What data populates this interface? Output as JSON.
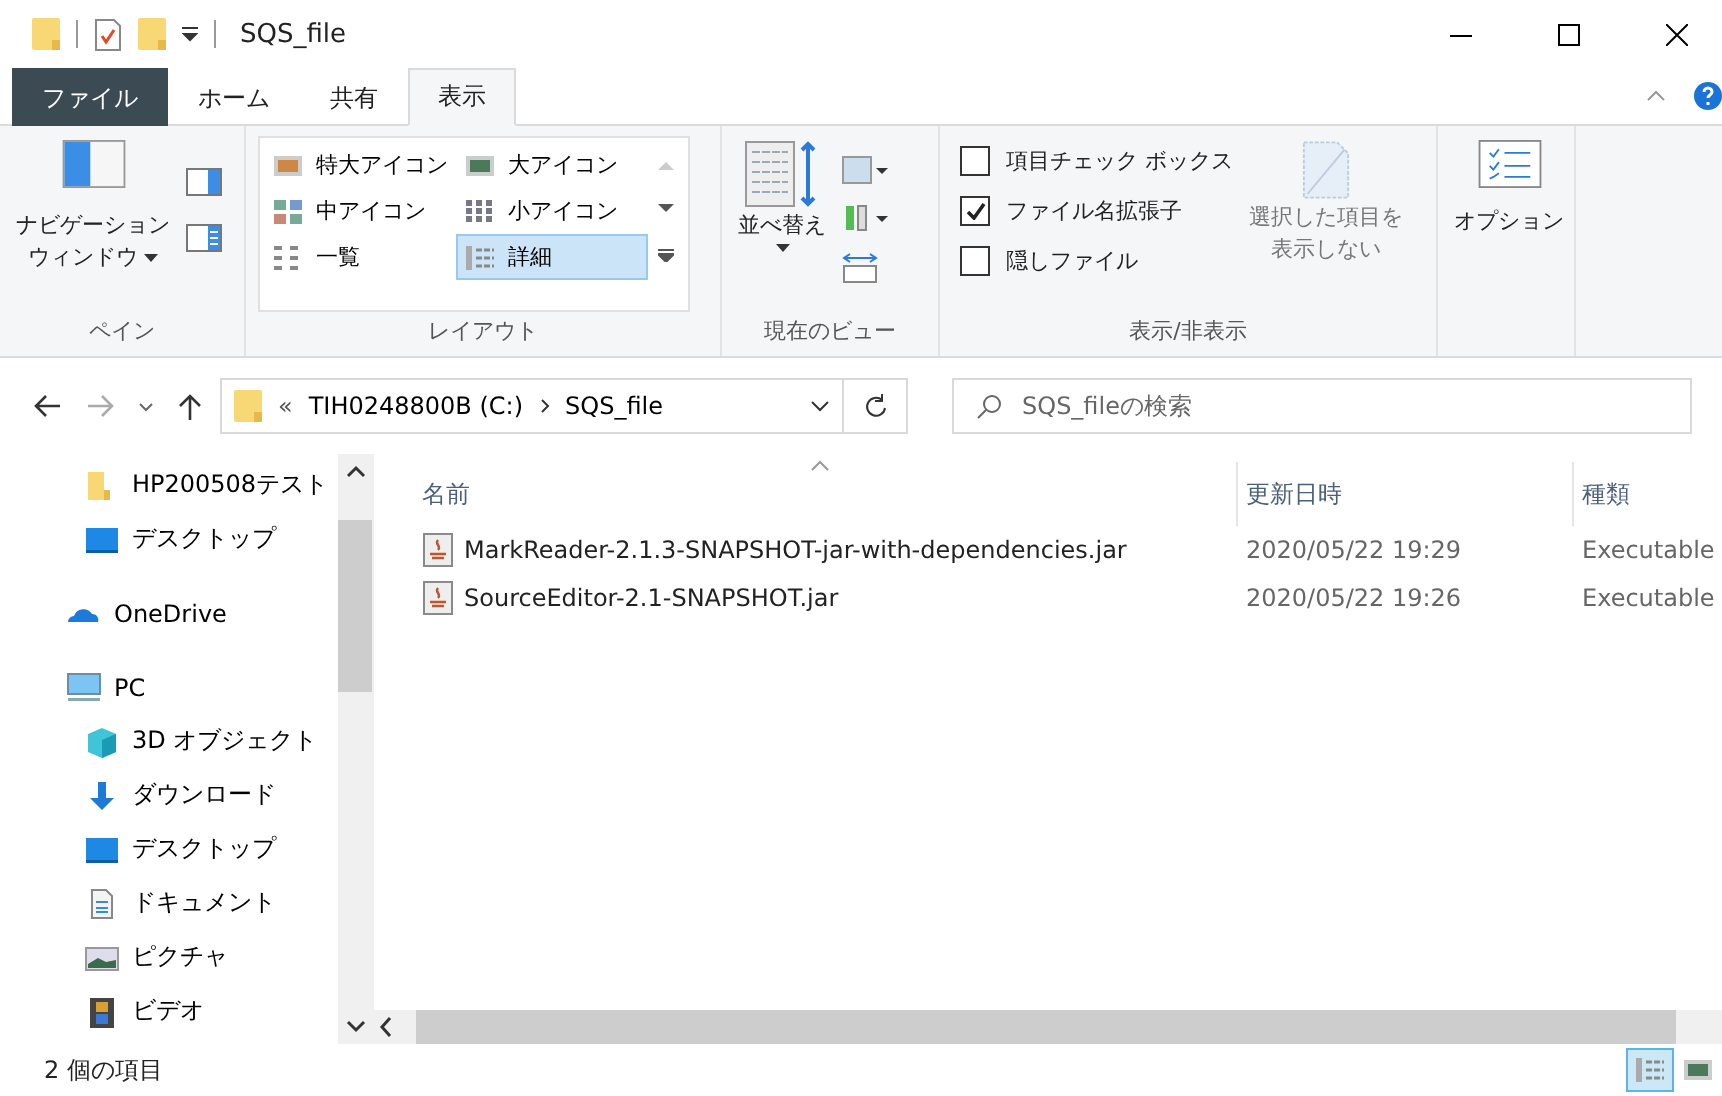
{
  "window": {
    "title": "SQS_file"
  },
  "ribbon_tabs": [
    {
      "label": "ファイル",
      "kind": "file",
      "selected": false
    },
    {
      "label": "ホーム",
      "kind": "tab",
      "selected": false
    },
    {
      "label": "共有",
      "kind": "tab",
      "selected": false
    },
    {
      "label": "表示",
      "kind": "tab",
      "selected": true
    }
  ],
  "ribbon": {
    "pane": {
      "label": "ペイン",
      "nav_button": [
        "ナビゲーション",
        "ウィンドウ"
      ]
    },
    "layout": {
      "label": "レイアウト",
      "options": [
        {
          "label": "特大アイコン",
          "kind": "xl",
          "selected": false
        },
        {
          "label": "大アイコン",
          "kind": "large",
          "selected": false
        },
        {
          "label": "中アイコン",
          "kind": "medium",
          "selected": false
        },
        {
          "label": "小アイコン",
          "kind": "small",
          "selected": false
        },
        {
          "label": "一覧",
          "kind": "list",
          "selected": false
        },
        {
          "label": "詳細",
          "kind": "details",
          "selected": true
        }
      ]
    },
    "current_view": {
      "label": "現在のビュー",
      "sort_button": "並べ替え"
    },
    "show_hide": {
      "label": "表示/非表示",
      "checkboxes": [
        {
          "label": "項目チェック ボックス",
          "checked": false
        },
        {
          "label": "ファイル名拡張子",
          "checked": true
        },
        {
          "label": "隠しファイル",
          "checked": false
        }
      ],
      "hide_button": [
        "選択した項目を",
        "表示しない"
      ]
    },
    "options": {
      "button": "オプション"
    }
  },
  "address": {
    "overflow": "«",
    "crumbs": [
      "TIH0248800B (C:)",
      "SQS_file"
    ]
  },
  "search": {
    "placeholder": "SQS_fileの検索"
  },
  "nav": {
    "quick_access": [
      {
        "label": "HP200508テスト",
        "kind": "folder"
      },
      {
        "label": "デスクトップ",
        "kind": "desktop"
      }
    ],
    "roots": [
      {
        "label": "OneDrive",
        "kind": "cloud"
      },
      {
        "label": "PC",
        "kind": "pc",
        "children": [
          {
            "label": "3D オブジェクト",
            "kind": "cube"
          },
          {
            "label": "ダウンロード",
            "kind": "download"
          },
          {
            "label": "デスクトップ",
            "kind": "desktop"
          },
          {
            "label": "ドキュメント",
            "kind": "document"
          },
          {
            "label": "ピクチャ",
            "kind": "pictures"
          },
          {
            "label": "ビデオ",
            "kind": "video"
          }
        ]
      }
    ]
  },
  "files": {
    "columns": [
      "名前",
      "更新日時",
      "種類"
    ],
    "rows": [
      {
        "name": "MarkReader-2.1.3-SNAPSHOT-jar-with-dependencies.jar",
        "modified": "2020/05/22 19:29",
        "type": "Executable"
      },
      {
        "name": "SourceEditor-2.1-SNAPSHOT.jar",
        "modified": "2020/05/22 19:26",
        "type": "Executable"
      }
    ]
  },
  "status_bar": {
    "count": "2 個の項目",
    "views": [
      {
        "kind": "details",
        "selected": true
      },
      {
        "kind": "large",
        "selected": false
      }
    ]
  }
}
